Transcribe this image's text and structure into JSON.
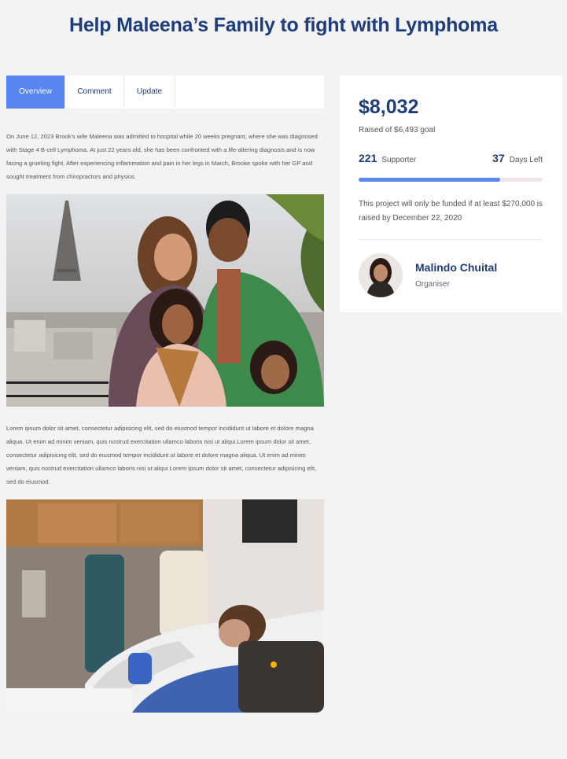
{
  "header": {
    "title": "Help Maleena’s Family to fight with Lymphoma"
  },
  "tabs": [
    {
      "label": "Overview",
      "active": true
    },
    {
      "label": "Comment",
      "active": false
    },
    {
      "label": "Update",
      "active": false
    }
  ],
  "content": {
    "paragraph_1": "On June 12, 2023 Brook’s wife Maleena was admitted to hospital while 20 weeks pregnant, where she was diagnosed with Stage 4 B-cell Lymphoma. At just 22 years old, she has been confronted with a life-altering diagnosis and is now facing a grueling fight. After experiencing inflammation and pain in her legs in March, Brooke spoke with her GP and sought treatment from chiropractors and physios.",
    "paragraph_2": "Lorem ipsum dolor sit amet, consectetur adipisicing elit, sed do eiusmod tempor incididunt ut labore et dolore magna aliqua. Ut enim ad minim veniam, quis nostrud exercitation ullamco laboris nisi ut aliqui.Lorem ipsum dolor sit amet, consectetur adipisicing elit, sed do eiusmod tempor incididunt ut labore et dolore magna aliqua. Ut enim ad minim veniam, quis nostrud exercitation ullamco laboris nisi ut aliqui.Lorem ipsum dolor sit amet, consectetur adipisicing elit, sed do eiusmod."
  },
  "campaign": {
    "raised": "$8,032",
    "goal_text": "Raised of $6,493 goal",
    "supporters_count": "221",
    "supporters_label": "Supporter",
    "days_count": "37",
    "days_label": "Days Left",
    "progress_percent": 77,
    "note": "This project will only be funded if at least $270,000 is raised by December 22, 2020",
    "organiser_name": "Malindo Chuital",
    "organiser_role": "Organiser"
  },
  "colors": {
    "primary": "#5a86f2",
    "heading": "#1f3d7a",
    "background": "#f3f3f3"
  }
}
